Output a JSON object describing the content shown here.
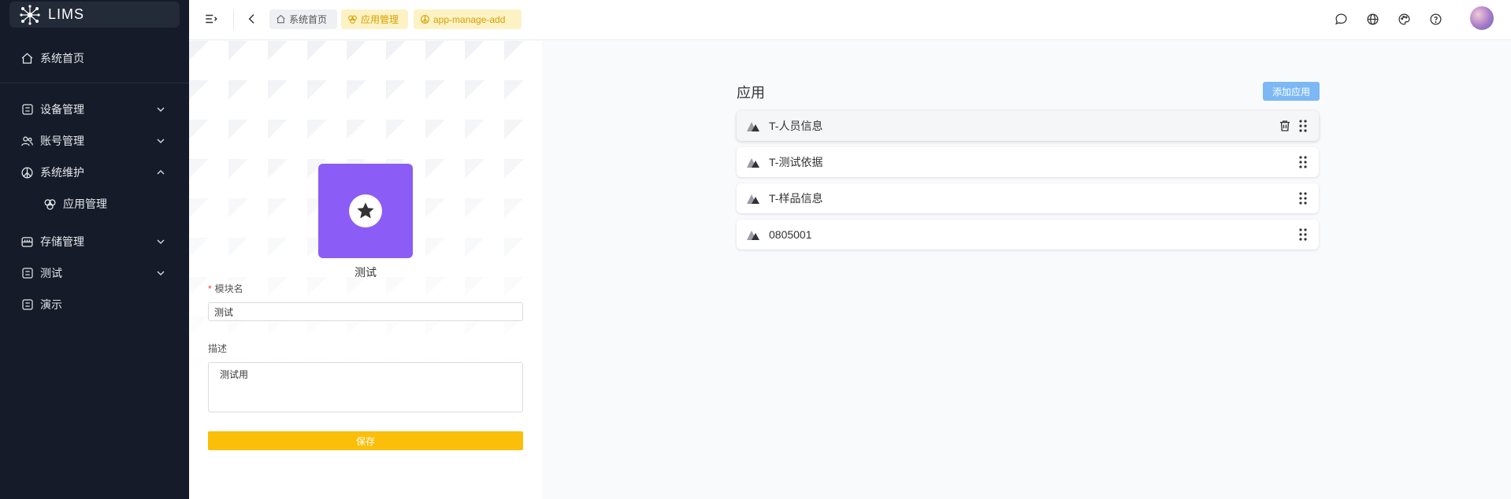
{
  "sidebar": {
    "logo_text": "LIMS",
    "items": [
      {
        "label": "系统首页",
        "icon": "home-icon"
      },
      {
        "label": "设备管理",
        "icon": "grid-icon",
        "chevron": "down"
      },
      {
        "label": "账号管理",
        "icon": "users-icon",
        "chevron": "down"
      },
      {
        "label": "系统维护",
        "icon": "peace-icon",
        "chevron": "up"
      },
      {
        "label": "应用管理",
        "icon": "app-icon",
        "sub": true
      },
      {
        "label": "存储管理",
        "icon": "storage-icon",
        "chevron": "down"
      },
      {
        "label": "测试",
        "icon": "grid-icon",
        "chevron": "down"
      },
      {
        "label": "演示",
        "icon": "grid-icon"
      }
    ]
  },
  "header": {
    "breadcrumbs": [
      {
        "label": "系统首页",
        "icon": "home-icon"
      },
      {
        "label": "应用管理",
        "icon": "app-icon"
      },
      {
        "label": "app-manage-add",
        "icon": "peace-icon"
      }
    ],
    "icons": [
      "message-icon",
      "globe-icon",
      "palette-icon",
      "help-icon"
    ]
  },
  "form": {
    "app_name": "测试",
    "module_label": "模块名",
    "required_mark": "*",
    "module_value": "测试",
    "desc_label": "描述",
    "desc_value": "测试用",
    "save_label": "保存"
  },
  "apps": {
    "title": "应用",
    "add_label": "添加应用",
    "items": [
      "T-人员信息",
      "T-测试依据",
      "T-样品信息",
      "0805001"
    ]
  },
  "colors": {
    "sidebar_bg": "#151b28",
    "accent_purple": "#8b5cf6",
    "save_yellow": "#fbbf0a",
    "add_blue": "#7cb8f4"
  }
}
